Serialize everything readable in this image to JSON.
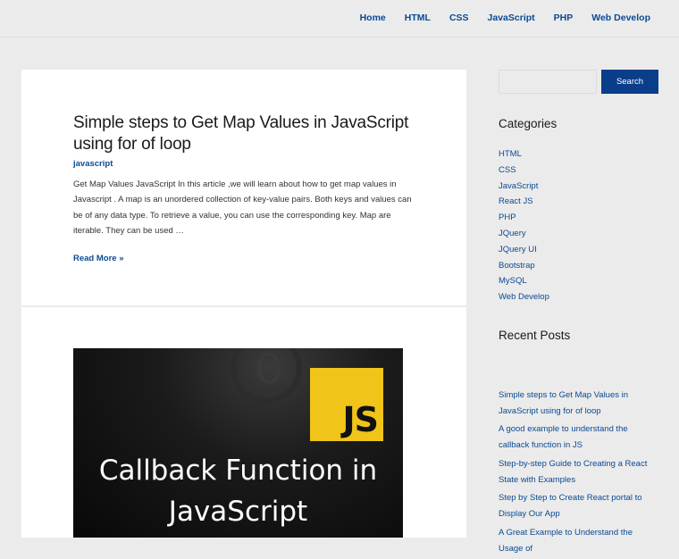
{
  "nav": {
    "items": [
      "Home",
      "HTML",
      "CSS",
      "JavaScript",
      "PHP",
      "Web Develop"
    ]
  },
  "post1": {
    "title": "Simple steps to Get Map Values in JavaScript using for of loop",
    "category": "javascript",
    "excerpt": "Get Map Values JavaScript In this article ,we will learn about how to get map values in Javascript . A map is an unordered collection of key-value pairs. Both keys and values can be of any data type. To retrieve a value, you can use the corresponding key. Map are iterable. They can be used …",
    "read_more": "Read More »"
  },
  "post2": {
    "image_badge": "JS",
    "image_text_line1": "Callback Function in",
    "image_text_line2": "JavaScript"
  },
  "sidebar": {
    "search_placeholder": "",
    "search_label": "Search",
    "categories_title": "Categories",
    "categories": [
      "HTML",
      "CSS",
      "JavaScript",
      "React JS",
      "PHP",
      "JQuery",
      "JQuery UI",
      "Bootstrap",
      "MySQL",
      "Web Develop"
    ],
    "recent_title": "Recent Posts",
    "recent_posts": [
      "Simple steps to Get Map Values in JavaScript using for of loop",
      "A good example to understand the callback function in JS",
      "Step-by-step Guide to Creating a React State with Examples",
      "Step by Step to Create React portal to Display Our App",
      "A Great Example to Understand the Usage of"
    ]
  },
  "colors": {
    "link": "#0a4a92",
    "button": "#0a3d8a",
    "js_yellow": "#f0c419"
  }
}
